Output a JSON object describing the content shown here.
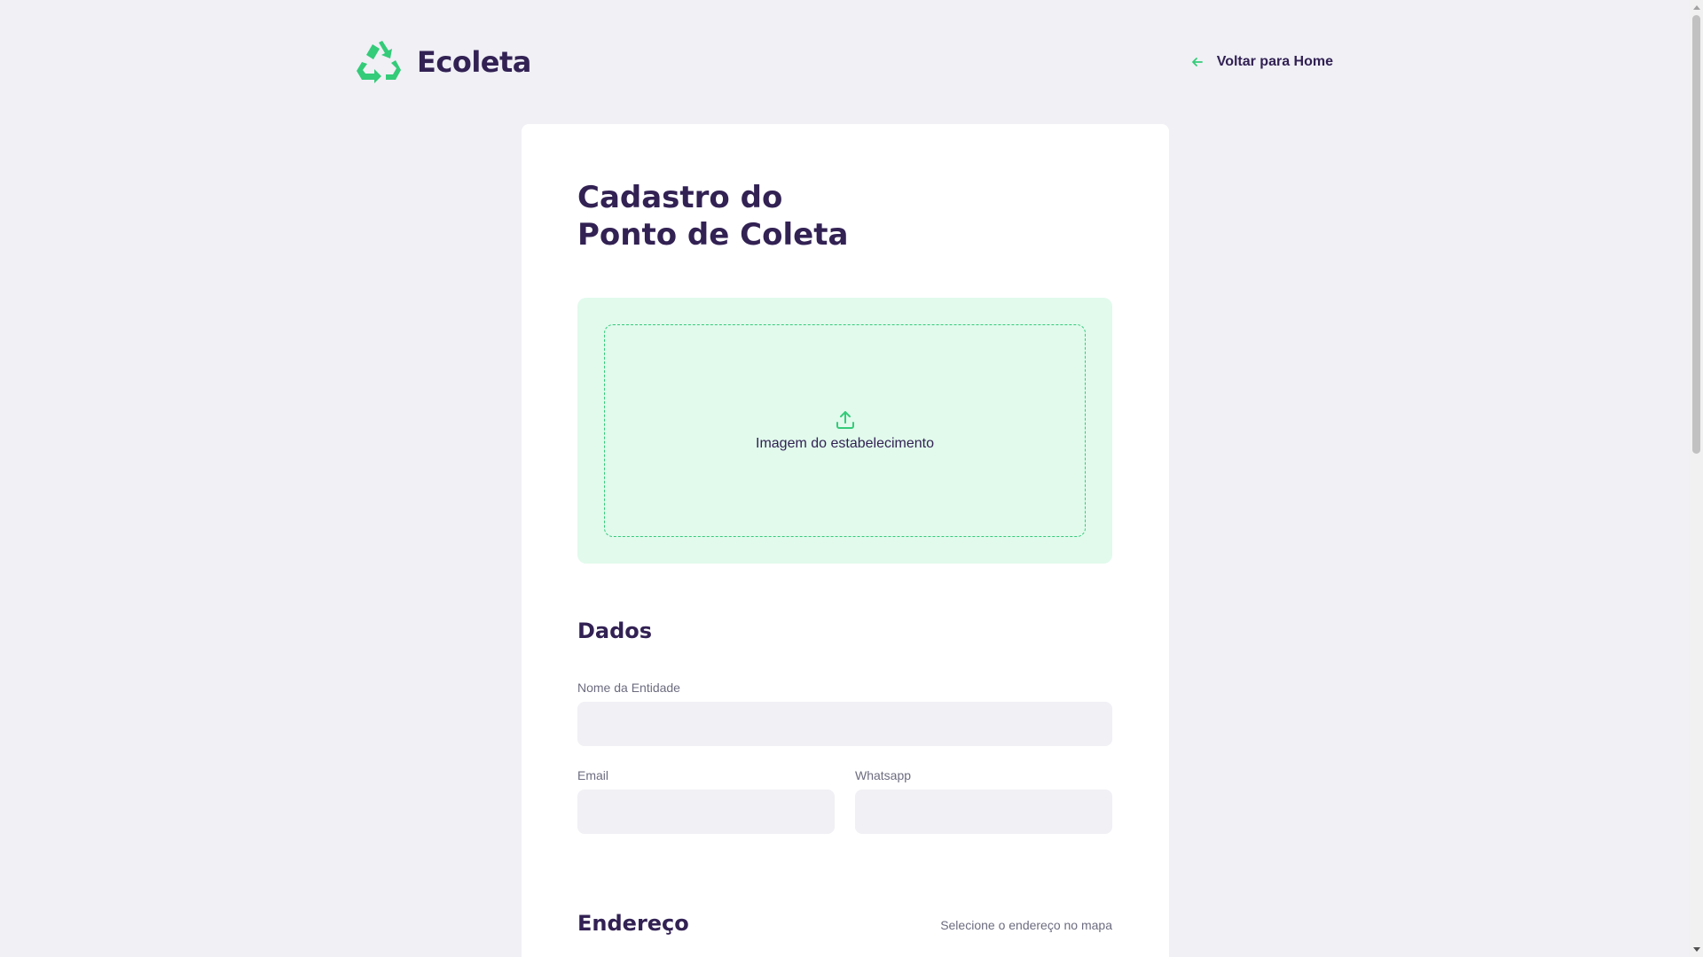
{
  "header": {
    "logo_text": "Ecoleta",
    "logo_icon": "recycle-icon",
    "back_link_label": "Voltar para Home",
    "back_link_icon": "arrow-left-icon"
  },
  "form": {
    "title_line1": "Cadastro do",
    "title_line2": "Ponto de Coleta",
    "dropzone": {
      "icon": "upload-icon",
      "text": "Imagem do estabelecimento"
    },
    "dados": {
      "heading": "Dados",
      "nome_label": "Nome da Entidade",
      "nome_value": "",
      "email_label": "Email",
      "email_value": "",
      "whatsapp_label": "Whatsapp",
      "whatsapp_value": ""
    },
    "endereco": {
      "heading": "Endereço",
      "hint": "Selecione o endereço no mapa"
    }
  },
  "colors": {
    "background": "#f0f0f5",
    "title": "#322153",
    "primary_green": "#34cb79",
    "light_green": "#e1faec",
    "text_muted": "#6c6c80"
  }
}
